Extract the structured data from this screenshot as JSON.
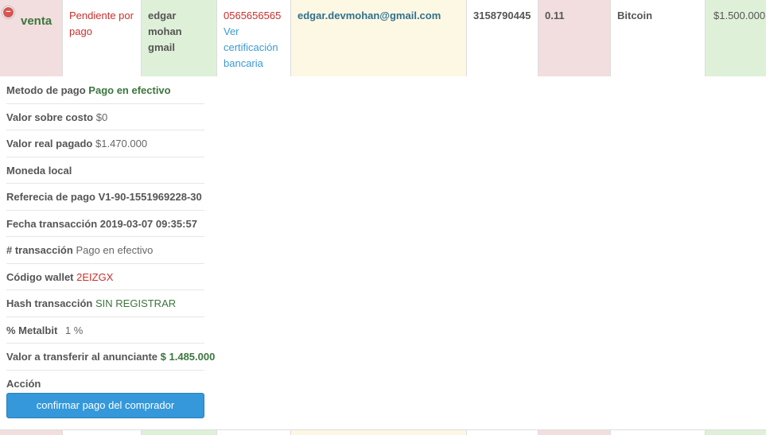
{
  "order": {
    "type": "venta",
    "status": "Pendiente por pago",
    "buyer_name": "edgar mohan gmail",
    "account": "0565656565",
    "cert_link": "Ver certificación bancaria",
    "email": "edgar.devmohan@gmail.com",
    "phone": "3158790445",
    "amount_crypto": "0.11",
    "currency": "Bitcoin",
    "price": "$1.500.000"
  },
  "details": {
    "metodo_label": "Metodo de pago",
    "metodo_value": "Pago en efectivo",
    "sobre_costo_label": "Valor sobre costo",
    "sobre_costo_value": "$0",
    "real_pagado_label": "Valor real pagado",
    "real_pagado_value": "$1.470.000",
    "moneda_label": "Moneda local",
    "referencia_label": "Referecia de pago",
    "referencia_value": "V1-90-1551969228-30",
    "fecha_label": "Fecha transacción",
    "fecha_value": "2019-03-07 09:35:57",
    "transaccion_label": "# transacción",
    "transaccion_value": "Pago en efectivo",
    "wallet_label": "Código wallet",
    "wallet_value": "2EIZGX",
    "hash_label": "Hash transacción",
    "hash_value": "SIN REGISTRAR",
    "metalbit_label": "% Metalbit",
    "metalbit_value": "1 %",
    "transferir_label": "Valor a transferir al anunciante",
    "transferir_value": "$ 1.485.000",
    "accion_label": "Acción",
    "confirm_button": "confirmar pago del comprador"
  },
  "colors": {
    "row_red": "#f2dede",
    "row_green": "#dff0d8",
    "row_yellow": "#fcf8e3",
    "primary_button": "#3498db"
  }
}
